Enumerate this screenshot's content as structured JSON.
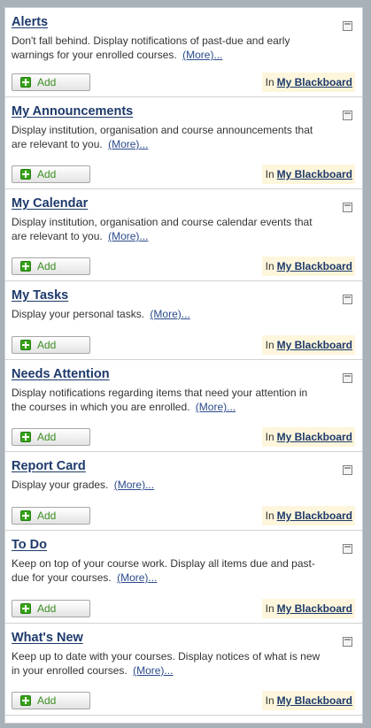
{
  "location_prefix": "In",
  "location_link": "My Blackboard",
  "add_label": "Add",
  "more_label": "(More)...",
  "modules": [
    {
      "title": "Alerts",
      "desc": "Don't fall behind. Display notifications of past-due and early warnings for your enrolled courses."
    },
    {
      "title": "My Announcements",
      "desc": "Display institution, organisation and course announcements that are relevant to you."
    },
    {
      "title": "My Calendar",
      "desc": "Display institution, organisation and course calendar events that are relevant to you."
    },
    {
      "title": "My Tasks",
      "desc": "Display your personal tasks."
    },
    {
      "title": "Needs Attention",
      "desc": "Display notifications regarding items that need your attention in the courses in which you are enrolled."
    },
    {
      "title": "Report Card",
      "desc": "Display your grades."
    },
    {
      "title": "To Do",
      "desc": "Keep on top of your course work. Display all items due and past-due for your courses."
    },
    {
      "title": "What's New",
      "desc": "Keep up to date with your courses. Display notices of what is new in your enrolled courses."
    }
  ]
}
